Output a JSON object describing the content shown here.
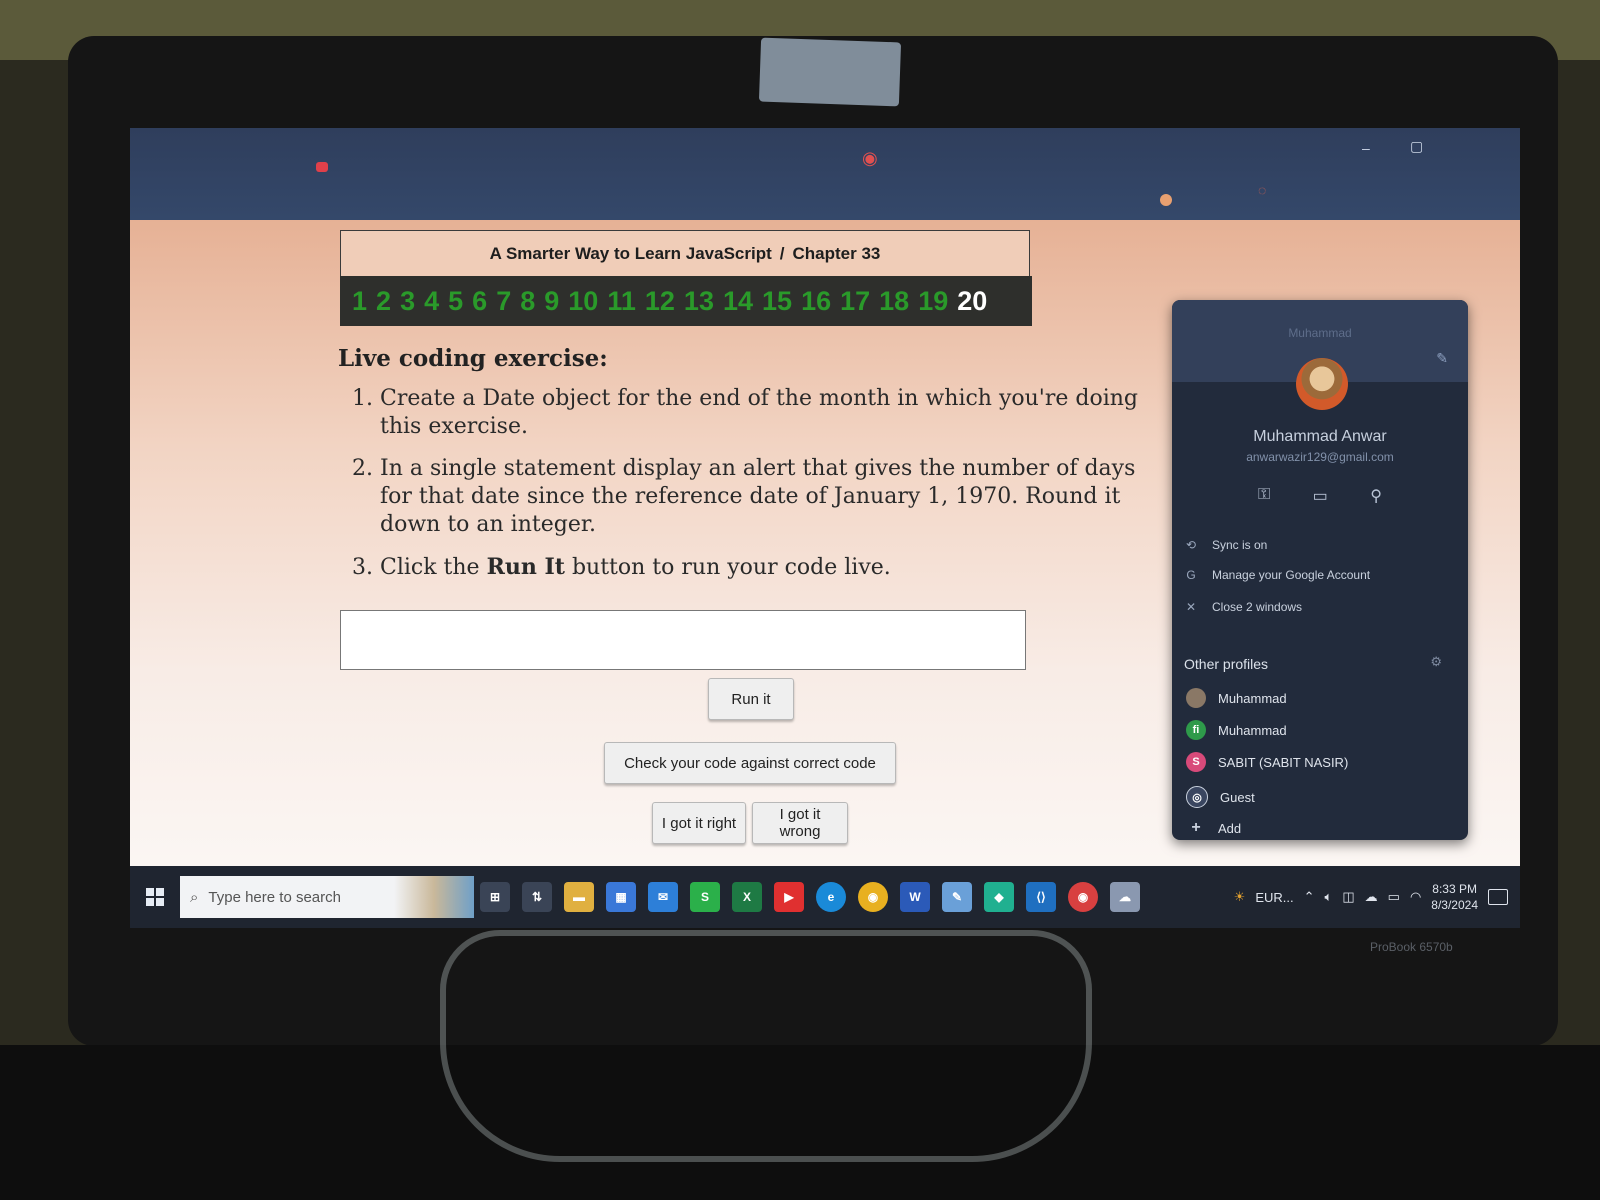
{
  "header": {
    "book_title": "A Smarter Way to Learn JavaScript",
    "separator": "/",
    "chapter": "Chapter 33"
  },
  "chapter_nav": {
    "numbers": [
      "1",
      "2",
      "3",
      "4",
      "5",
      "6",
      "7",
      "8",
      "9",
      "10",
      "11",
      "12",
      "13",
      "14",
      "15",
      "16",
      "17",
      "18",
      "19",
      "20"
    ],
    "current": "20"
  },
  "exercise": {
    "title": "Live coding exercise:",
    "step1": "Create a Date object for the end of the month in which you're doing this exercise.",
    "step2": "In a single statement display an alert that gives the number of days for that date since the reference date of January 1, 1970. Round it down to an integer.",
    "step3_prefix": "Click the ",
    "step3_bold": "Run It",
    "step3_suffix": " button to run your code live."
  },
  "code_input": {
    "value": ""
  },
  "buttons": {
    "run": "Run it",
    "check": "Check your code against correct code",
    "right": "I got it right",
    "wrong": "I got it wrong"
  },
  "profile": {
    "header_name": "Muhammad",
    "name": "Muhammad Anwar",
    "email": "anwarwazir129@gmail.com",
    "sync": "Sync is on",
    "manage": "Manage your Google Account",
    "close": "Close 2 windows",
    "other_title": "Other profiles",
    "others": [
      {
        "name": "Muhammad",
        "initial": "",
        "color": "#8a7866"
      },
      {
        "name": "Muhammad",
        "initial": "fi",
        "color": "#2e9a4a"
      },
      {
        "name": "SABIT (SABIT NASIR)",
        "initial": "S",
        "color": "#d84a7a"
      },
      {
        "name": "Guest",
        "initial": "◎",
        "color": "#3a4660"
      },
      {
        "name": "Add",
        "initial": "+",
        "color": "transparent"
      }
    ]
  },
  "taskbar": {
    "search_placeholder": "Type here to search",
    "weather": "EUR...",
    "time": "8:33 PM",
    "date": "8/3/2024"
  },
  "device": {
    "model": "ProBook 6570b"
  }
}
